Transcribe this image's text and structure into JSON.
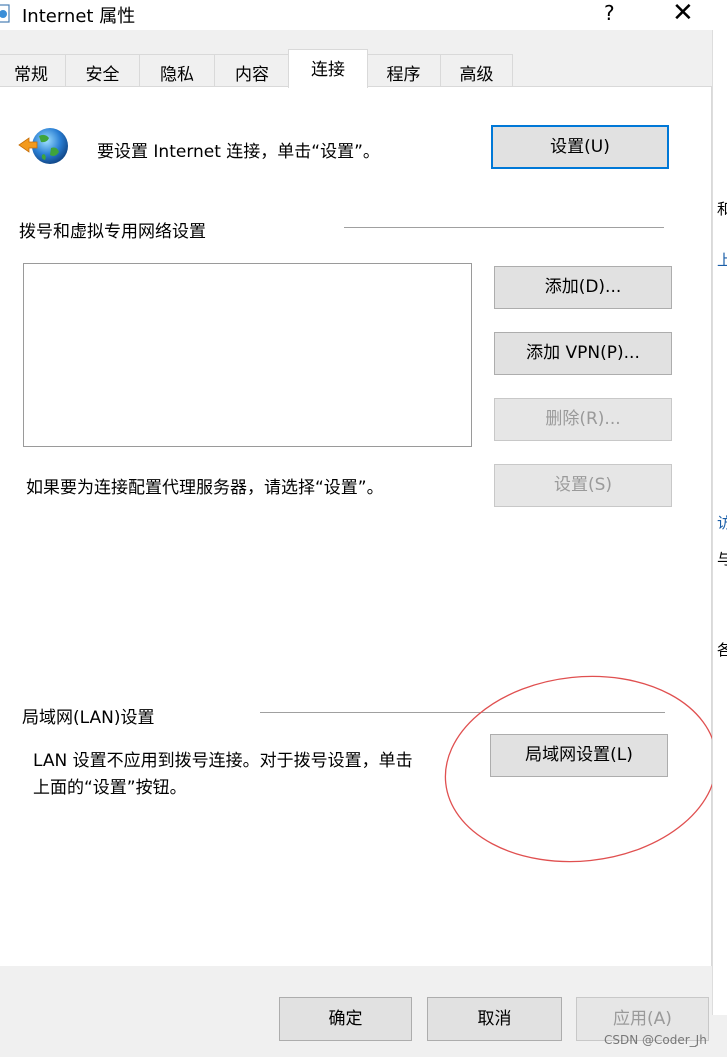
{
  "window": {
    "title": "Internet 属性",
    "help_label": "?",
    "close_label": "✕"
  },
  "tabs": [
    {
      "label": "常规"
    },
    {
      "label": "安全"
    },
    {
      "label": "隐私"
    },
    {
      "label": "内容"
    },
    {
      "label": "连接"
    },
    {
      "label": "程序"
    },
    {
      "label": "高级"
    }
  ],
  "active_tab": "连接",
  "connection": {
    "setup_text": "要设置 Internet 连接，单击“设置”。",
    "setup_button": "设置(U)"
  },
  "dialup": {
    "heading": "拨号和虚拟专用网络设置",
    "add_button": "添加(D)...",
    "add_vpn_button": "添加 VPN(P)...",
    "delete_button": "删除(R)...",
    "proxy_text": "如果要为连接配置代理服务器，请选择“设置”。",
    "settings_button": "设置(S)"
  },
  "lan": {
    "heading": "局域网(LAN)设置",
    "desc_line1": "LAN 设置不应用到拨号连接。对于拨号设置，单击",
    "desc_line2": "上面的“设置”按钮。",
    "lan_button": "局域网设置(L)"
  },
  "footer": {
    "ok_button": "确定",
    "cancel_button": "取消",
    "apply_button": "应用(A)"
  },
  "right_strip": [
    "和",
    "上",
    "访",
    "与",
    "各"
  ],
  "watermark": "CSDN @Coder_Jh",
  "colors": {
    "accent": "#0078d7",
    "annotation": "#e05050"
  }
}
